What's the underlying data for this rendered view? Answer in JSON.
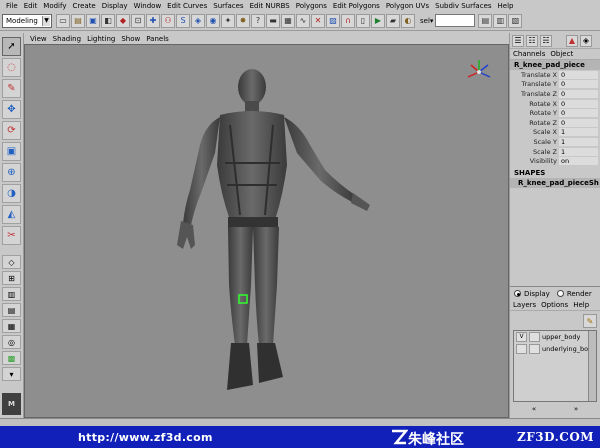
{
  "menubar": [
    "File",
    "Edit",
    "Modify",
    "Create",
    "Display",
    "Window",
    "Edit Curves",
    "Surfaces",
    "Edit NURBS",
    "Polygons",
    "Edit Polygons",
    "Polygon UVs",
    "Subdiv Surfaces",
    "Help"
  ],
  "shelf": {
    "mode": "Modeling",
    "sel_label": "sel▾"
  },
  "panel_menu": [
    "View",
    "Shading",
    "Lighting",
    "Show",
    "Panels"
  ],
  "channel_box": {
    "tabs": [
      "Channels",
      "Object"
    ],
    "object_name": "R_knee_pad_piece",
    "attributes": [
      {
        "label": "Translate X",
        "value": "0"
      },
      {
        "label": "Translate Y",
        "value": "0"
      },
      {
        "label": "Translate Z",
        "value": "0"
      },
      {
        "label": "Rotate X",
        "value": "0"
      },
      {
        "label": "Rotate Y",
        "value": "0"
      },
      {
        "label": "Rotate Z",
        "value": "0"
      },
      {
        "label": "Scale X",
        "value": "1"
      },
      {
        "label": "Scale Y",
        "value": "1"
      },
      {
        "label": "Scale Z",
        "value": "1"
      },
      {
        "label": "Visibility",
        "value": "on"
      }
    ],
    "shapes_header": "SHAPES",
    "shape_name": "R_knee_pad_pieceSh"
  },
  "layer_editor": {
    "display_label": "Display",
    "render_label": "Render",
    "menu": [
      "Layers",
      "Options",
      "Help"
    ],
    "layers": [
      {
        "visible": "V",
        "name": "upper_body"
      },
      {
        "visible": "",
        "name": "underlying_bo"
      }
    ],
    "nav_left": "«",
    "nav_right": "»"
  },
  "banner": {
    "url": "http://www.zf3d.com",
    "cn_text": "朱峰社区",
    "brand": "ZF3D.COM"
  },
  "colors": {
    "viewport_bg": "#8e8e8e",
    "ui_bg": "#c8c8c8",
    "banner_bg": "#1020b8",
    "selection_green": "#30ff30"
  }
}
